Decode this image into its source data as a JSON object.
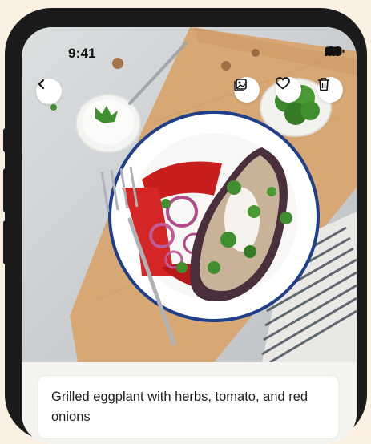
{
  "status_bar": {
    "time": "9:41"
  },
  "header": {
    "back_icon": "chevron-left-icon",
    "actions": [
      {
        "id": "gallery",
        "icon": "image-gallery-icon"
      },
      {
        "id": "favorite",
        "icon": "heart-icon"
      },
      {
        "id": "delete",
        "icon": "trash-icon"
      }
    ]
  },
  "recipe": {
    "title": "Grilled eggplant with herbs, tomato, and red onions"
  },
  "colors": {
    "background": "#fbf0e1",
    "frame": "#1b1b1c",
    "card": "#ffffff",
    "plate_rim": "#1f3f8a"
  }
}
